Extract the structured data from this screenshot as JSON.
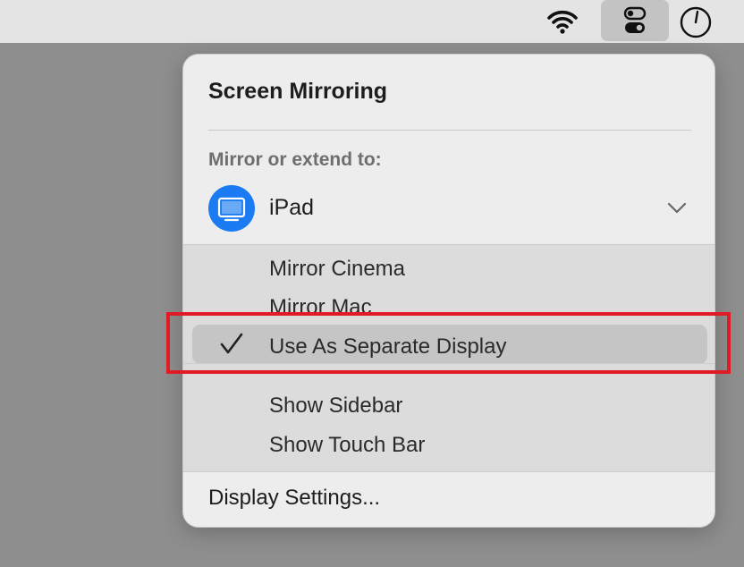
{
  "menubar": {
    "icons": [
      "wifi-icon",
      "control-center-icon",
      "clock-icon"
    ]
  },
  "panel": {
    "title": "Screen Mirroring",
    "section_label": "Mirror or extend to:",
    "device": {
      "name": "iPad",
      "icon": "display-icon",
      "icon_color": "#1a7bf2",
      "expanded": true
    },
    "options": [
      {
        "label": "Mirror Cinema",
        "checked": false
      },
      {
        "label": "Mirror Mac",
        "checked": false
      },
      {
        "label": "Use As Separate Display",
        "checked": true
      }
    ],
    "extras": [
      {
        "label": "Show Sidebar"
      },
      {
        "label": "Show Touch Bar"
      }
    ],
    "footer": "Display Settings..."
  },
  "annotation": {
    "highlight_color": "#e01b24"
  }
}
